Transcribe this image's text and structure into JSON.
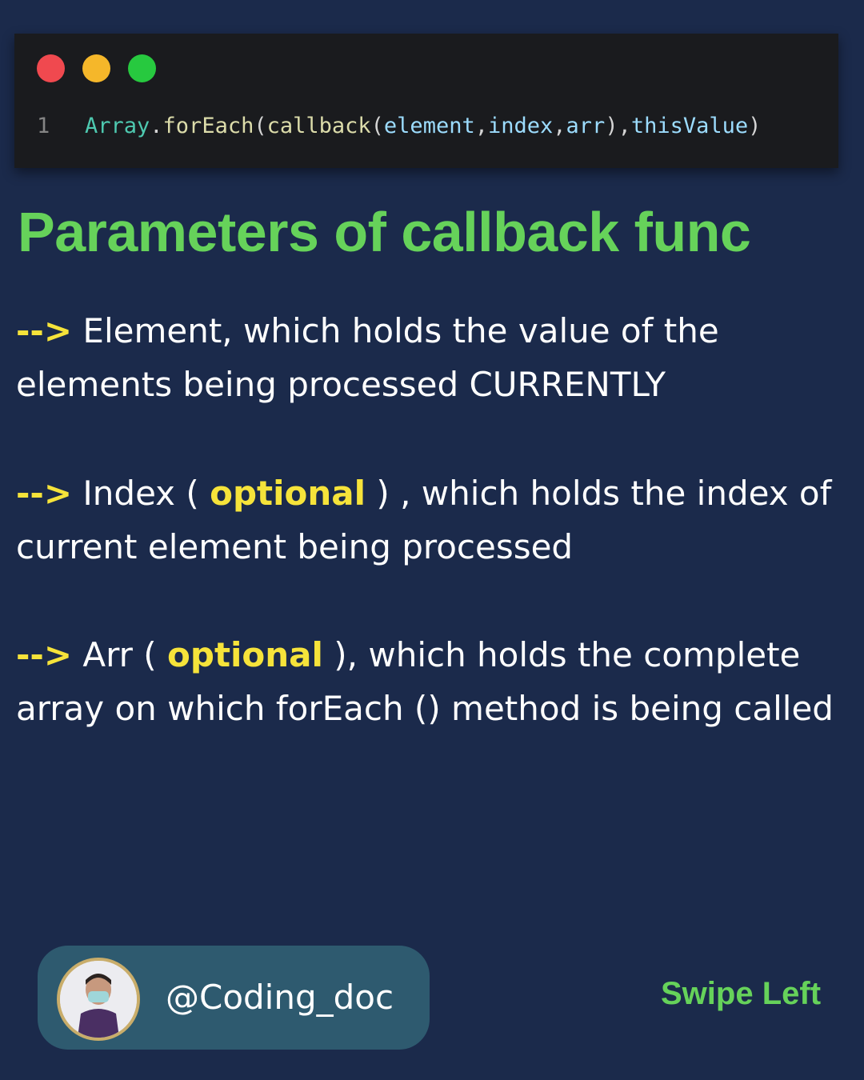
{
  "code": {
    "line_number": "1",
    "tokens": {
      "class_name": "Array",
      "dot": ".",
      "method": "forEach",
      "open1": "(",
      "callback": "callback",
      "open2": "(",
      "p1": "element",
      "c1": ",",
      "p2": "index",
      "c2": ",",
      "p3": "arr",
      "close2": ")",
      "c3": ",",
      "p4": "thisValue",
      "close1": ")"
    }
  },
  "title": "Parameters of callback func",
  "params": [
    {
      "arrow": "-->",
      "text": " Element, which holds the value of the elements being processed CURRENTLY"
    },
    {
      "arrow": "-->",
      "pre": " Index ( ",
      "optional": "optional",
      "post": " ) , which holds the index of current element being processed"
    },
    {
      "arrow": "-->",
      "pre": " Arr ( ",
      "optional": "optional",
      "post": " ), which holds the complete array on which forEach () method is being called"
    }
  ],
  "profile": {
    "handle": "@Coding_doc"
  },
  "swipe_label": "Swipe Left",
  "colors": {
    "background": "#1b2a4b",
    "title_green": "#66d25a",
    "highlight_yellow": "#f6e33a",
    "pill": "#2e5a6f"
  }
}
